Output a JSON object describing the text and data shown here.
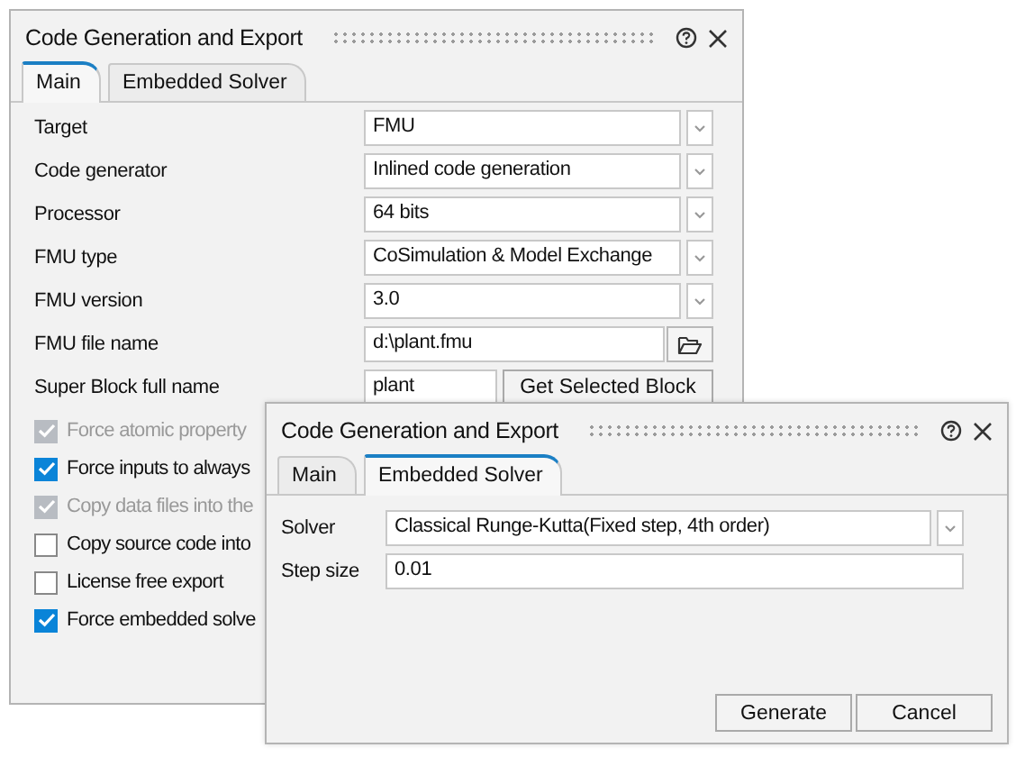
{
  "windows": [
    {
      "title": "Code Generation and Export",
      "tabs": [
        {
          "label": "Main",
          "selected": true
        },
        {
          "label": "Embedded Solver",
          "selected": false
        }
      ],
      "fields": [
        {
          "kind": "dropdown",
          "label": "Target",
          "value": "FMU"
        },
        {
          "kind": "dropdown",
          "label": "Code generator",
          "value": "Inlined code generation"
        },
        {
          "kind": "dropdown",
          "label": "Processor",
          "value": "64 bits"
        },
        {
          "kind": "dropdown",
          "label": "FMU type",
          "value": "CoSimulation & Model Exchange"
        },
        {
          "kind": "dropdown",
          "label": "FMU version",
          "value": "3.0"
        },
        {
          "kind": "file",
          "label": "FMU file name",
          "value": "d:\\plant.fmu"
        },
        {
          "kind": "text_button",
          "label": "Super Block full name",
          "value": "plant",
          "button": "Get Selected Block"
        }
      ],
      "checkboxes": [
        {
          "label": "Force atomic property",
          "checked": true,
          "disabled": true
        },
        {
          "label": "Force inputs to always",
          "checked": true,
          "disabled": false
        },
        {
          "label": "Copy data files into the",
          "checked": true,
          "disabled": true
        },
        {
          "label": "Copy source code into",
          "checked": false,
          "disabled": false
        },
        {
          "label": "License free export",
          "checked": false,
          "disabled": false
        },
        {
          "label": "Force embedded solve",
          "checked": true,
          "disabled": false
        }
      ]
    },
    {
      "title": "Code Generation and Export",
      "tabs": [
        {
          "label": "Main",
          "selected": false
        },
        {
          "label": "Embedded Solver",
          "selected": true
        }
      ],
      "fields": [
        {
          "kind": "dropdown",
          "label": "Solver",
          "value": "Classical Runge-Kutta(Fixed step, 4th order)"
        },
        {
          "kind": "text",
          "label": "Step size",
          "value": "0.01"
        }
      ],
      "buttons": [
        "Generate",
        "Cancel"
      ]
    }
  ]
}
